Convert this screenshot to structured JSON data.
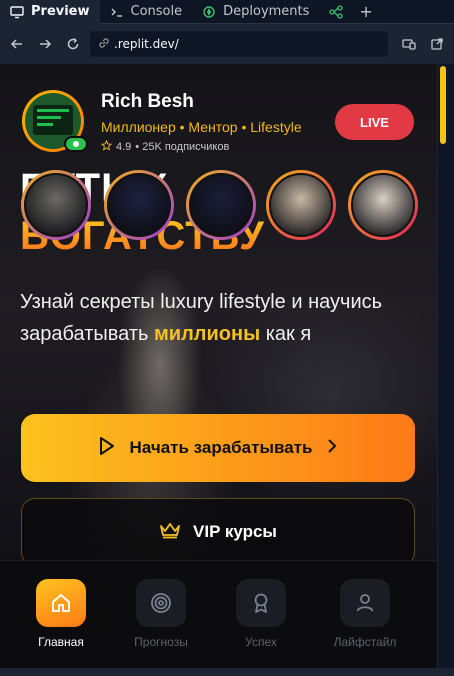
{
  "browser": {
    "tabs": [
      {
        "label": "Preview",
        "icon": "monitor-icon"
      },
      {
        "label": "Console",
        "icon": "terminal-icon"
      },
      {
        "label": "Deployments",
        "icon": "rocket-icon"
      }
    ],
    "url_host": ".replit.dev/"
  },
  "profile": {
    "name": "Rich Besh",
    "tags": "Миллионер • Ментор • Lifestyle",
    "rating": "4.9",
    "stats_suffix": "• 25K подписчиков",
    "live_label": "LIVE"
  },
  "hero": {
    "headline_line1": "ПУТЬ К",
    "headline_line2": "БОГАТСТВУ",
    "subtitle_before": "Узнай секреты luxury lifestyle и научись зарабатывать ",
    "subtitle_highlight": "миллионы",
    "subtitle_after": " как я"
  },
  "actions": {
    "primary_label": "Начать зарабатывать",
    "vip_label": "VIP курсы"
  },
  "stories": [
    {
      "colors": [
        "#f2b01c",
        "#9b3cd8"
      ],
      "tone": "#6b6a66"
    },
    {
      "colors": [
        "#f2b01c",
        "#9b3cd8"
      ],
      "tone": "#1e2140"
    },
    {
      "colors": [
        "#f2b01c",
        "#9b3cd8"
      ],
      "tone": "#1b1e3a"
    },
    {
      "colors": [
        "#f2b01c",
        "#e0245e"
      ],
      "tone": "#c9b7a3"
    },
    {
      "colors": [
        "#f2b01c",
        "#e0245e"
      ],
      "tone": "#d9cfc4"
    }
  ],
  "nav": [
    {
      "label": "Главная",
      "icon": "home-icon",
      "active": true
    },
    {
      "label": "Прогнозы",
      "icon": "target-icon",
      "active": false
    },
    {
      "label": "Успех",
      "icon": "award-icon",
      "active": false
    },
    {
      "label": "Лайфстайл",
      "icon": "user-icon",
      "active": false
    }
  ],
  "colors": {
    "accent": "#f6c027",
    "live": "#e23a44",
    "scroll_thumb": "#f2c40f"
  }
}
